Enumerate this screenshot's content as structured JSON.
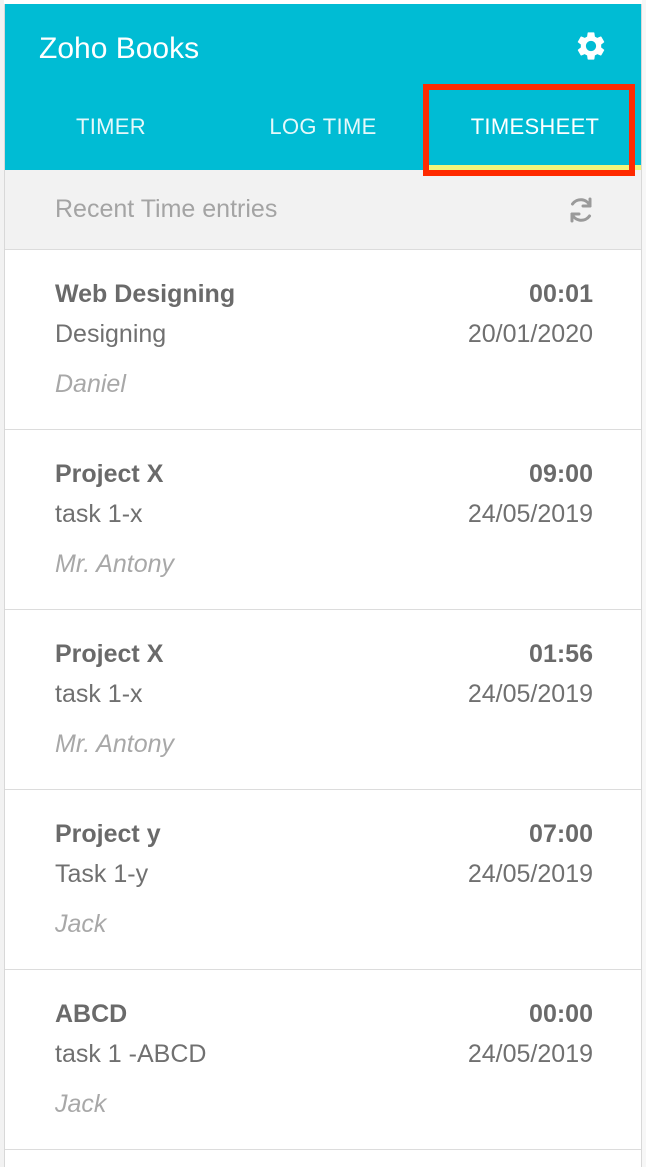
{
  "header": {
    "title": "Zoho Books",
    "settings_icon": "gear-icon",
    "accent_color": "#00bcd4",
    "active_tab_indicator_color": "#f2f57a",
    "highlight_color": "#ff2a00"
  },
  "tabs": [
    {
      "label": "TIMER",
      "active": false
    },
    {
      "label": "LOG TIME",
      "active": false
    },
    {
      "label": "TIMESHEET",
      "active": true
    }
  ],
  "section": {
    "title": "Recent Time entries",
    "refresh_icon": "refresh-icon"
  },
  "entries": [
    {
      "project": "Web Designing",
      "duration": "00:01",
      "task": "Designing",
      "date": "20/01/2020",
      "user": "Daniel"
    },
    {
      "project": "Project X",
      "duration": "09:00",
      "task": "task 1-x",
      "date": "24/05/2019",
      "user": "Mr. Antony"
    },
    {
      "project": "Project X",
      "duration": "01:56",
      "task": "task 1-x",
      "date": "24/05/2019",
      "user": "Mr. Antony"
    },
    {
      "project": "Project y",
      "duration": "07:00",
      "task": "Task 1-y",
      "date": "24/05/2019",
      "user": "Jack"
    },
    {
      "project": "ABCD",
      "duration": "00:00",
      "task": "task 1 -ABCD",
      "date": "24/05/2019",
      "user": "Jack"
    }
  ]
}
